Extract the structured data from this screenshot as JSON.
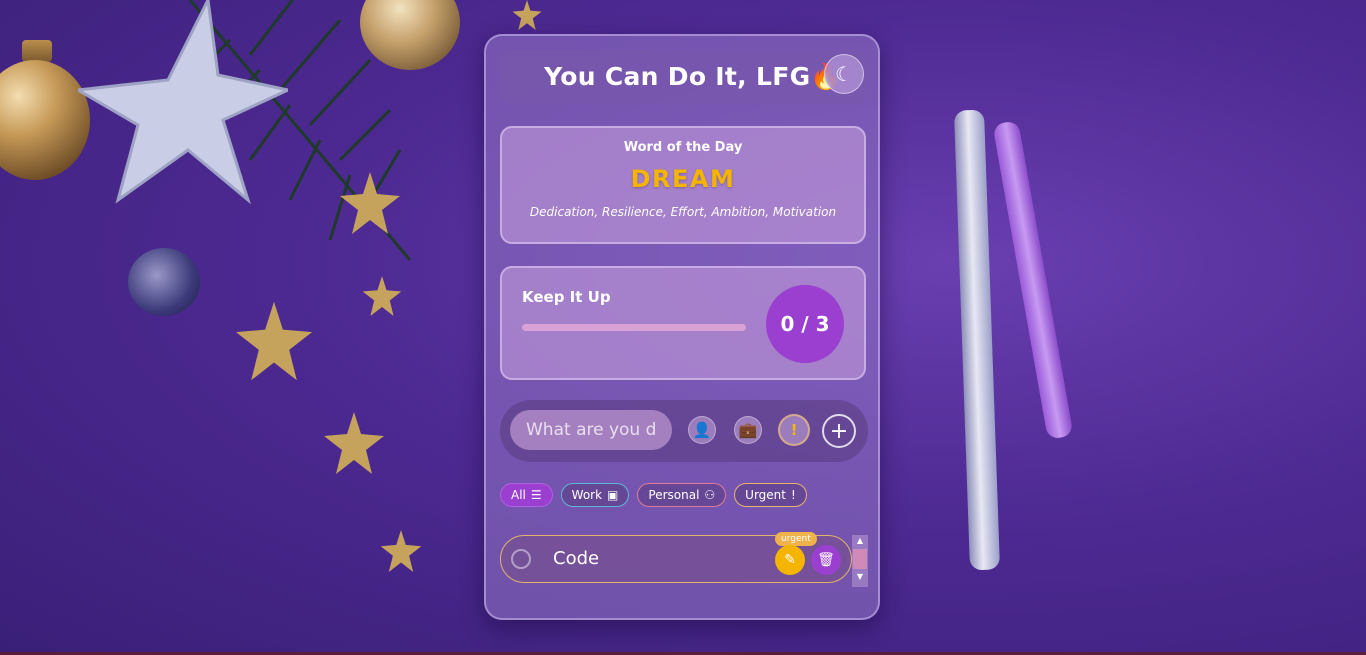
{
  "app": {
    "title": "You Can Do It, LFG🔥"
  },
  "theme_toggle": {
    "icon": "moon-icon",
    "glyph": "☾"
  },
  "word_of_day": {
    "label": "Word of the Day",
    "word": "DREAM",
    "meaning": "Dedication, Resilience, Effort, Ambition, Motivation",
    "word_color": "#f5b400"
  },
  "progress": {
    "label": "Keep It Up",
    "count_text": "0 / 3",
    "completed": 0,
    "total": 3,
    "accent": "#9a3fd0"
  },
  "entry": {
    "placeholder": "What are you doing today?",
    "categories": [
      {
        "name": "personal",
        "icon": "user-icon",
        "glyph": "👤"
      },
      {
        "name": "work",
        "icon": "briefcase-icon",
        "glyph": "💼"
      },
      {
        "name": "urgent",
        "icon": "exclamation-icon",
        "glyph": "!"
      }
    ],
    "add_glyph": "+"
  },
  "filters": [
    {
      "label": "All",
      "icon": "list-icon",
      "glyph": "☰"
    },
    {
      "label": "Work",
      "icon": "briefcase-icon",
      "glyph": "▣"
    },
    {
      "label": "Personal",
      "icon": "user-icon",
      "glyph": "⚇"
    },
    {
      "label": "Urgent",
      "icon": "exclamation-icon",
      "glyph": "!"
    }
  ],
  "tasks": [
    {
      "text": "Code",
      "badge": "urgent",
      "edit_glyph": "✎",
      "delete_glyph": "🗑"
    }
  ],
  "scrollbar": {
    "up": "▲",
    "down": "▼"
  }
}
